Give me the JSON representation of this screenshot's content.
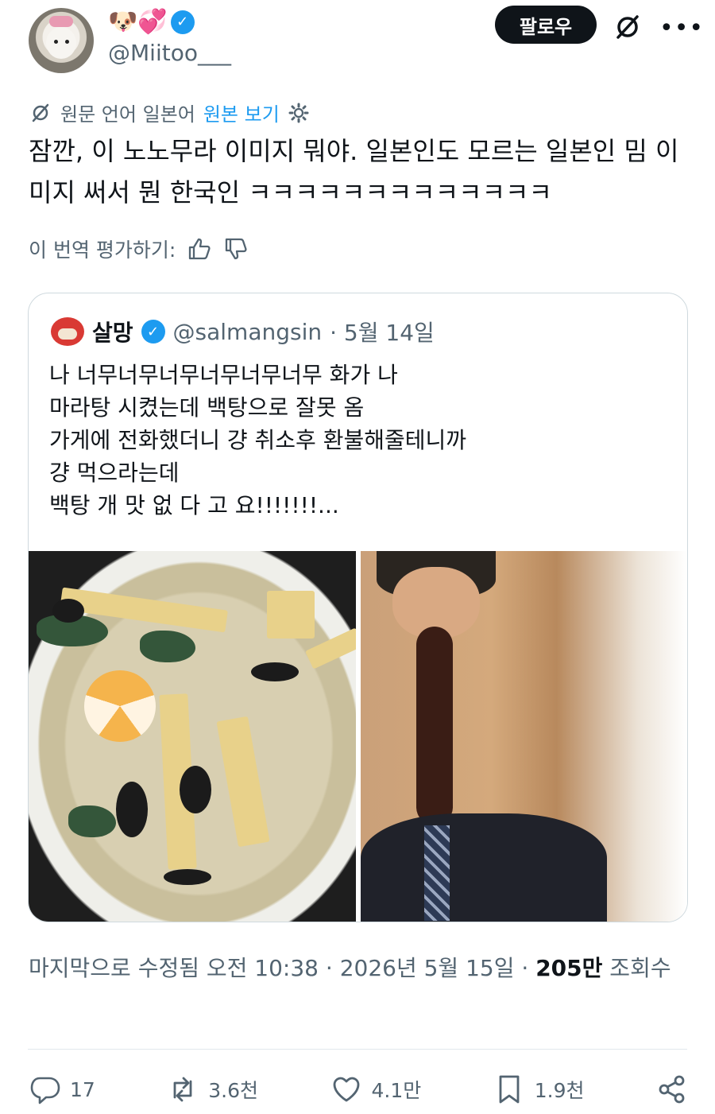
{
  "header": {
    "emojis": "🐶💞",
    "handle": "@Miitoo___",
    "follow_label": "팔로우",
    "more_label": "•••"
  },
  "translation": {
    "source_text": "원문 언어 일본어",
    "show_original": "원본 보기"
  },
  "tweet": {
    "text": "잠깐, 이 노노무라 이미지 뭐야. 일본인도 모르는 일본인 밈 이미지 써서 뭔 한국인 ㅋㅋㅋㅋㅋㅋㅋㅋㅋㅋㅋㅋㅋ"
  },
  "rate": {
    "label": "이 번역 평가하기:"
  },
  "quote": {
    "name": "살망",
    "handle": "@salmangsin",
    "date": "· 5월 14일",
    "text": "나 너무너무너무너무너무너무 화가 나\n마라탕 시켰는데 백탕으로 잘못 옴\n가게에 전화했더니 걍 취소후 환불해줄테니까\n걍 먹으라는데\n백탕 개 맛 없 다 고 요!!!!!!!..."
  },
  "meta": {
    "edited": "마지막으로 수정됨 오전 10:38 · 2026년 5월 15일 · ",
    "views_count": "205만",
    "views_label": " 조회수"
  },
  "actions": {
    "replies": "17",
    "reposts": "3.6천",
    "likes": "4.1만",
    "bookmarks": "1.9천"
  }
}
